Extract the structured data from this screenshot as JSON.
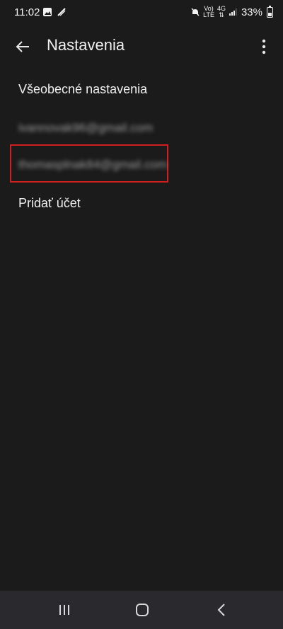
{
  "status_bar": {
    "time": "11:02",
    "network_top": "Vo)",
    "network_bottom": "LTE",
    "network_type": "4G",
    "battery_percent": "33%",
    "battery_level": 0.33
  },
  "app_bar": {
    "title": "Nastavenia"
  },
  "menu": {
    "general_settings": "Všeobecné nastavenia",
    "account_1": "ivannovak96@gmail.com",
    "account_2": "thomasplnak84@gmail.com",
    "add_account": "Pridať účet"
  },
  "icons": {
    "back": "arrow-left-icon",
    "more": "more-vertical-icon",
    "recents": "recents-icon",
    "home": "home-icon",
    "nav_back": "chevron-left-icon"
  },
  "colors": {
    "background": "#1b1b1b",
    "highlight": "#d01f1f",
    "nav_bar": "#2a2a2e"
  }
}
